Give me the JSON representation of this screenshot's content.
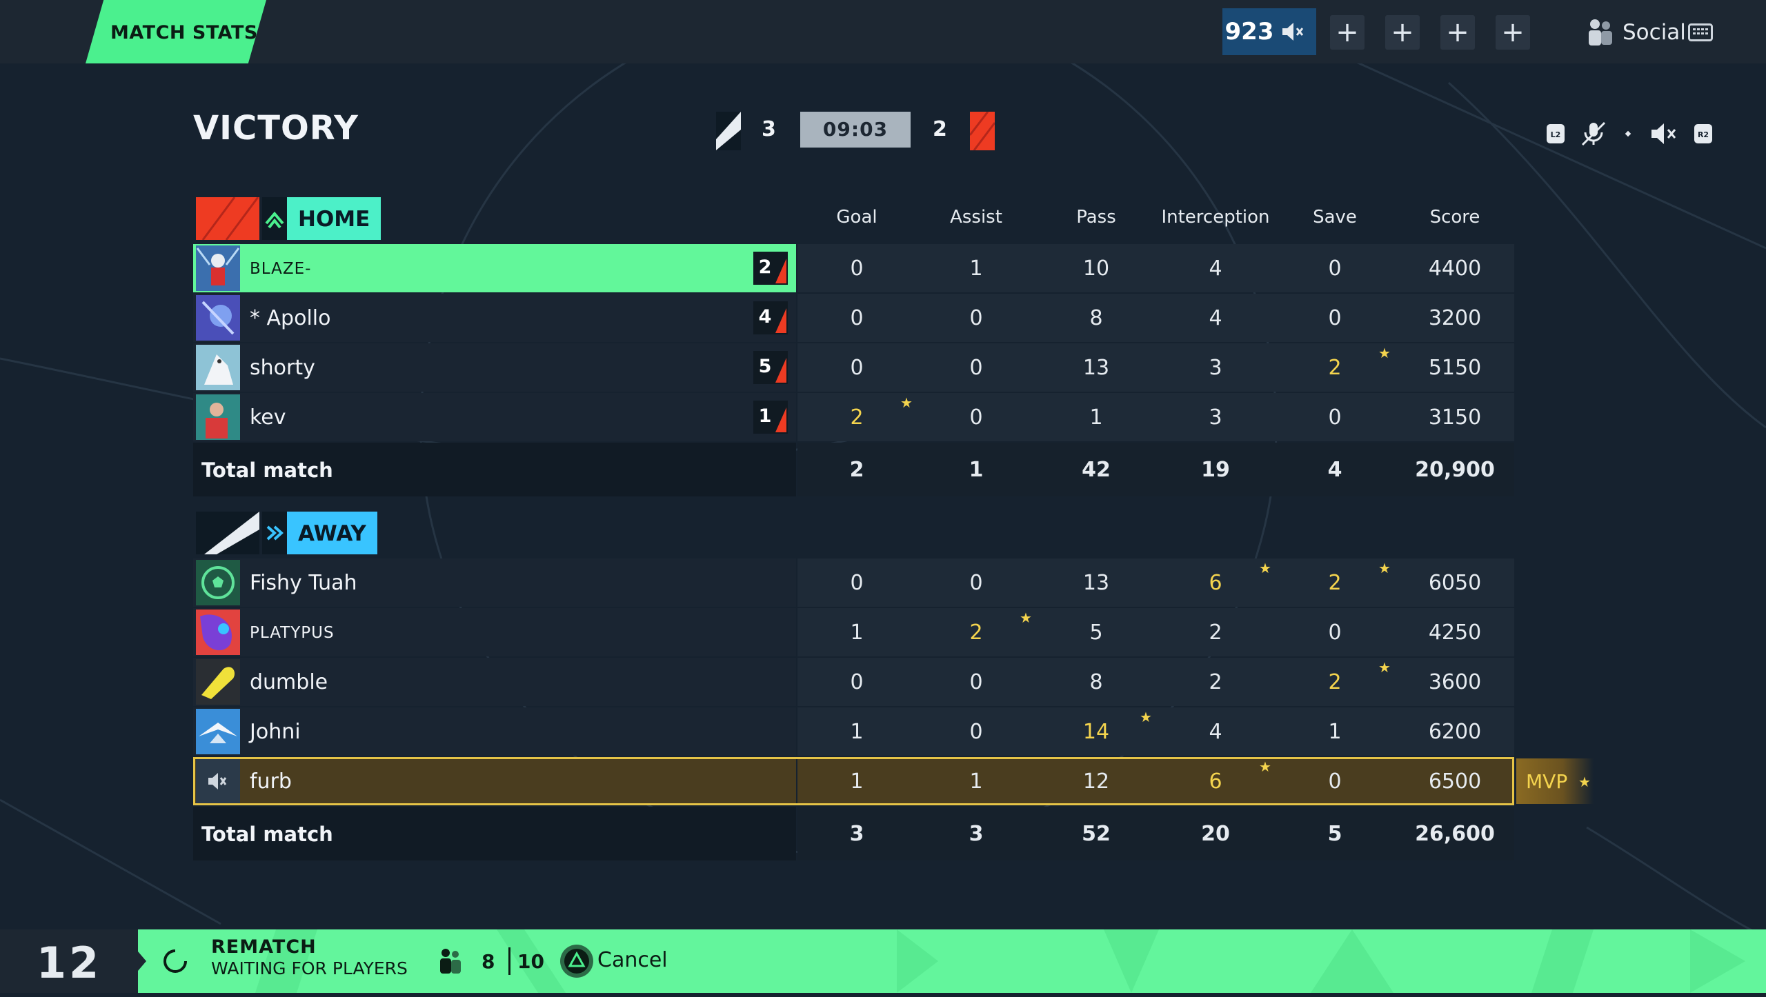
{
  "topbar": {
    "tab_label": "MATCH STATS",
    "rank_value": "923",
    "plus_buttons": [
      "+",
      "+",
      "+",
      "+"
    ],
    "social_label": "Social"
  },
  "header": {
    "result": "VICTORY",
    "home_score": "3",
    "timer": "09:03",
    "away_score": "2"
  },
  "columns": [
    "Goal",
    "Assist",
    "Pass",
    "Interception",
    "Save",
    "Score"
  ],
  "home": {
    "label": "HOME",
    "players": [
      {
        "name": "BLAZE-",
        "slot": "2",
        "stats": [
          "0",
          "1",
          "10",
          "4",
          "0",
          "4400"
        ],
        "best": []
      },
      {
        "name": "* Apollo",
        "slot": "4",
        "stats": [
          "0",
          "0",
          "8",
          "4",
          "0",
          "3200"
        ],
        "best": []
      },
      {
        "name": "shorty",
        "slot": "5",
        "stats": [
          "0",
          "0",
          "13",
          "3",
          "2",
          "5150"
        ],
        "best": [
          4
        ]
      },
      {
        "name": "kev",
        "slot": "1",
        "stats": [
          "2",
          "0",
          "1",
          "3",
          "0",
          "3150"
        ],
        "best": [
          0
        ]
      }
    ],
    "total_label": "Total match",
    "totals": [
      "2",
      "1",
      "42",
      "19",
      "4",
      "20,900"
    ]
  },
  "away": {
    "label": "AWAY",
    "players": [
      {
        "name": "Fishy Tuah",
        "stats": [
          "0",
          "0",
          "13",
          "6",
          "2",
          "6050"
        ],
        "best": [
          3,
          4
        ]
      },
      {
        "name": "PLATYPUS",
        "stats": [
          "1",
          "2",
          "5",
          "2",
          "0",
          "4250"
        ],
        "best": [
          1
        ]
      },
      {
        "name": "dumble",
        "stats": [
          "0",
          "0",
          "8",
          "2",
          "2",
          "3600"
        ],
        "best": [
          4
        ]
      },
      {
        "name": "Johni",
        "stats": [
          "1",
          "0",
          "14",
          "4",
          "1",
          "6200"
        ],
        "best": [
          2
        ]
      },
      {
        "name": "furb",
        "stats": [
          "1",
          "1",
          "12",
          "6",
          "0",
          "6500"
        ],
        "best": [
          3
        ]
      }
    ],
    "total_label": "Total match",
    "totals": [
      "3",
      "3",
      "52",
      "20",
      "5",
      "26,600"
    ]
  },
  "mvp_label": "MVP",
  "footer": {
    "countdown": "12",
    "rematch_title": "REMATCH",
    "rematch_status": "WAITING FOR PLAYERS",
    "players_ready": "8",
    "players_max": "10",
    "cancel_label": "Cancel"
  },
  "colors": {
    "accent_green": "#62f79a",
    "home_red": "#ee3b22",
    "away_cyan": "#39c4ff",
    "highlight_yellow": "#f4d44e"
  }
}
